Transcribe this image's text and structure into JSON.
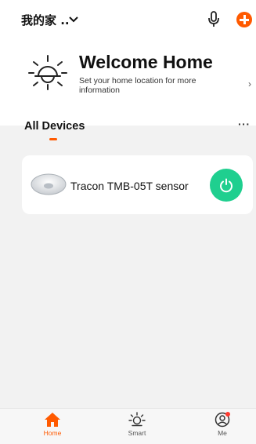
{
  "header": {
    "home_name": "我的家 .."
  },
  "welcome": {
    "title": "Welcome Home",
    "subtitle": "Set your home location for more information"
  },
  "devices": {
    "section_title": "All Devices",
    "more_label": "···",
    "items": [
      {
        "name": "Tracon TMB-05T sensor"
      }
    ]
  },
  "nav": {
    "items": [
      {
        "label": "Home",
        "icon": "home-icon",
        "active": true
      },
      {
        "label": "Smart",
        "icon": "sun-icon",
        "active": false
      },
      {
        "label": "Me",
        "icon": "person-icon",
        "active": false
      }
    ]
  },
  "colors": {
    "accent": "#ff5a00",
    "power": "#1fcf8f",
    "badge": "#ff3b30"
  }
}
